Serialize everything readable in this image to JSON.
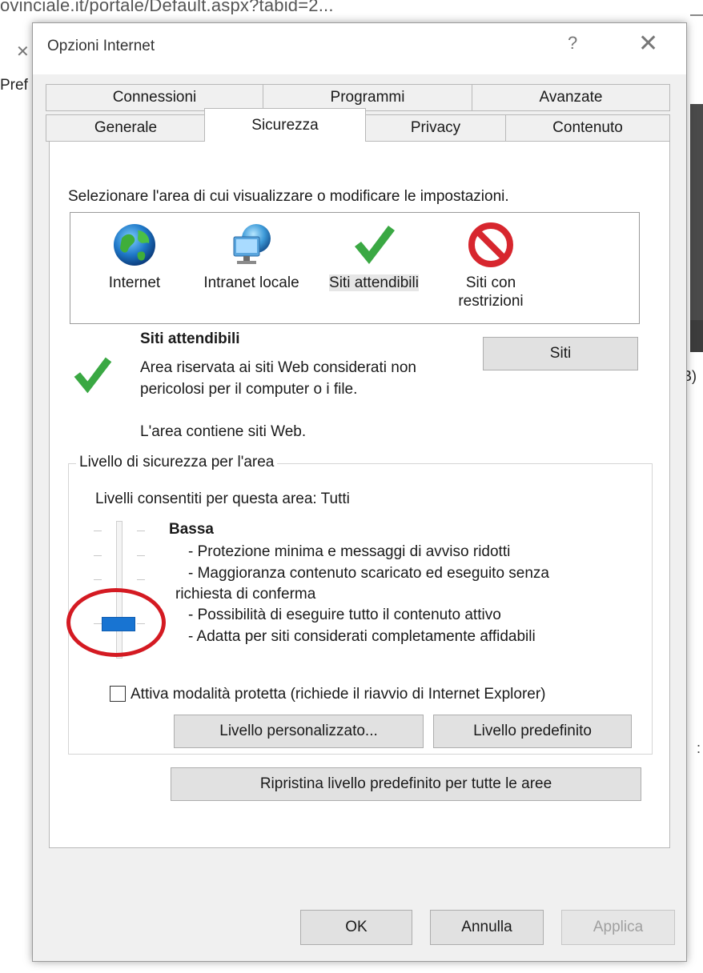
{
  "background": {
    "url_fragment": "ovinciale.it/portale/Default.aspx?tabid=2...",
    "pref_text": "Pref",
    "right_text": "B)",
    "right_dots": ":"
  },
  "dialog": {
    "title": "Opzioni Internet",
    "help": "?",
    "close": "✕"
  },
  "tabs": {
    "row1": [
      "Connessioni",
      "Programmi",
      "Avanzate"
    ],
    "row2": [
      "Generale",
      "Sicurezza",
      "Privacy",
      "Contenuto"
    ],
    "active": "Sicurezza"
  },
  "security": {
    "select_zone_label": "Selezionare l'area di cui visualizzare o modificare le impostazioni.",
    "zones": [
      {
        "label": "Internet",
        "icon": "globe-icon"
      },
      {
        "label": "Intranet locale",
        "icon": "intranet-globe-icon"
      },
      {
        "label": "Siti attendibili",
        "icon": "checkmark-icon",
        "selected": true
      },
      {
        "label": "Siti con restrizioni",
        "icon": "no-entry-icon"
      }
    ],
    "zone_title": "Siti attendibili",
    "zone_desc_line1": "Area riservata ai siti Web considerati non",
    "zone_desc_line2": "pericolosi per il computer o i file.",
    "zone_status": "L'area contiene siti Web.",
    "sites_button": "Siti",
    "group_title": "Livello di sicurezza per l'area",
    "allowed_levels": "Livelli consentiti per questa area: Tutti",
    "level_name": "Bassa",
    "level_desc": [
      "- Protezione minima e messaggi di avviso ridotti",
      "- Maggioranza contenuto scaricato ed eseguito senza",
      "richiesta di conferma",
      "- Possibilità di eseguire tutto il contenuto attivo",
      "- Adatta per siti considerati completamente affidabili"
    ],
    "slider_level": "Bassa",
    "protected_mode_label": "Attiva modalità protetta (richiede il riavvio di Internet Explorer)",
    "protected_mode_checked": false,
    "custom_level_button": "Livello personalizzato...",
    "default_level_button": "Livello predefinito",
    "reset_all_button": "Ripristina livello predefinito per tutte le aree"
  },
  "footer": {
    "ok": "OK",
    "cancel": "Annulla",
    "apply": "Applica"
  },
  "colors": {
    "slider_thumb": "#1874d2",
    "annotation_circle": "#d41a22",
    "check_green": "#3aa843",
    "no_entry_red": "#d7262e"
  }
}
